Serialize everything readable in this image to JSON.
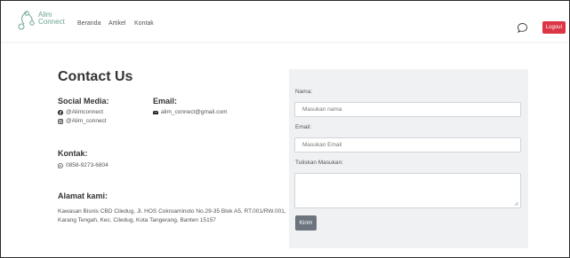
{
  "navbar": {
    "brand_line1": "Alim",
    "brand_line2": "Connect",
    "links": [
      "Beranda",
      "Artikel",
      "Kontak"
    ],
    "logout_label": "Logout"
  },
  "contact": {
    "title": "Contact Us",
    "social_heading": "Social Media:",
    "facebook": "@Alimconnect",
    "instagram": "@Alim_connect",
    "email_heading": "Email:",
    "email": "alim_connect@gmail.com",
    "kontak_heading": "Kontak:",
    "phone": "0858-9273-6804",
    "alamat_heading": "Alamat kami:",
    "alamat": "Kawasan Bisnis CBD Ciledug, Jl. HOS Cokroaminoto No.29-35 Blok A5, RT.001/RW.001, Karang Tengah, Kec. Ciledug, Kota Tangerang, Banten 15157"
  },
  "form": {
    "nama_label": "Nama:",
    "nama_placeholder": "Masukan nama",
    "email_label": "Email:",
    "email_placeholder": "Masukan Email",
    "masukan_label": "Tuliskan Masukan:",
    "submit_label": "Kirim"
  },
  "colors": {
    "brand": "#6aa58e",
    "logout": "#dc3545",
    "panel": "#f0f1f3",
    "submit": "#6c757d"
  },
  "icons": [
    "logo-icon",
    "chat-icon",
    "facebook-icon",
    "instagram-icon",
    "envelope-icon",
    "whatsapp-icon"
  ]
}
